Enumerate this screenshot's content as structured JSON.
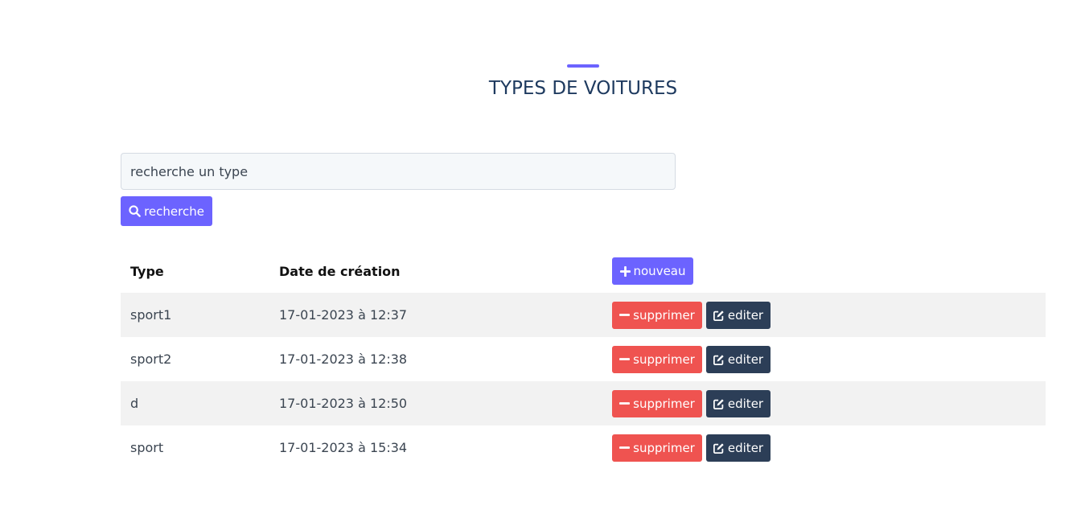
{
  "header": {
    "title": "TYPES DE VOITURES",
    "accent_color": "#6c63ff"
  },
  "search": {
    "placeholder": "recherche un type",
    "button_label": "recherche",
    "button_icon": "search-icon"
  },
  "table": {
    "columns": [
      "Type",
      "Date de création"
    ],
    "new_button_label": "nouveau",
    "delete_label": "supprimer",
    "edit_label": "editer",
    "rows": [
      {
        "type": "sport1",
        "date": "17-01-2023 à 12:37"
      },
      {
        "type": "sport2",
        "date": "17-01-2023 à 12:38"
      },
      {
        "type": "d",
        "date": "17-01-2023 à 12:50"
      },
      {
        "type": "sport",
        "date": "17-01-2023 à 15:34"
      }
    ]
  },
  "colors": {
    "primary": "#6c63ff",
    "danger": "#ef5350",
    "dark": "#2c3e57",
    "title": "#1e3a5f"
  }
}
